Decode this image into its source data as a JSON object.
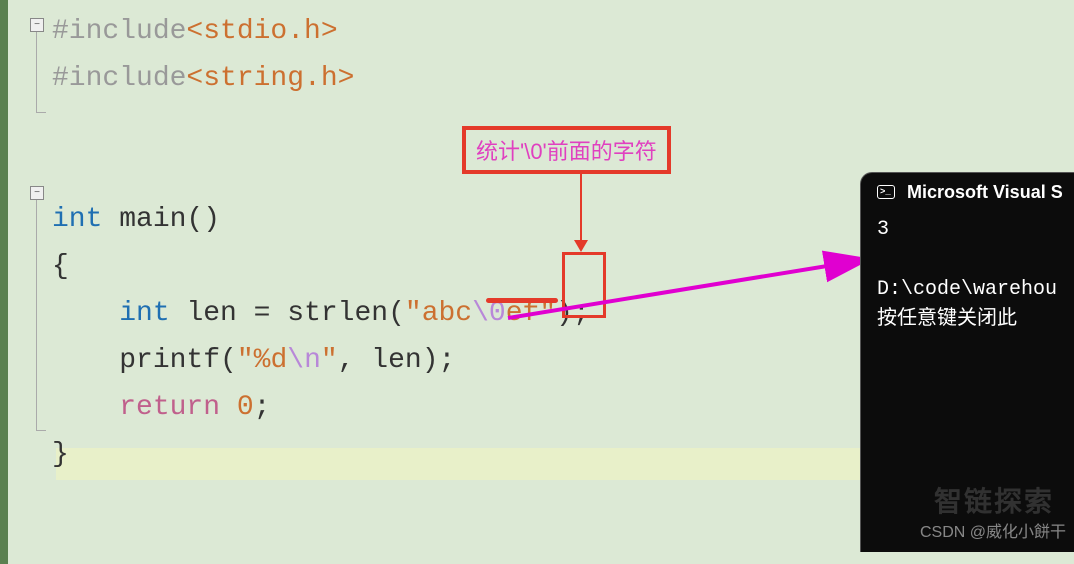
{
  "code": {
    "include1": {
      "pre": "#include",
      "hdr": "<stdio.h>"
    },
    "include2": {
      "pre": "#include",
      "hdr": "<string.h>"
    },
    "main_type": "int",
    "main_name": " main()",
    "brace_open": "{",
    "line_decl": {
      "indent": "    ",
      "type": "int",
      "rest": " len = strlen(",
      "str_q1": "\"abc",
      "esc": "\\0",
      "str_q2": "ef\"",
      "end": ");"
    },
    "line_print": {
      "indent": "    ",
      "fn": "printf(",
      "str": "\"%d",
      "esc": "\\n",
      "str2": "\"",
      "rest": ", len);"
    },
    "line_ret": {
      "indent": "    ",
      "kw": "return",
      "sp": " ",
      "num": "0",
      "end": ";"
    },
    "brace_close": "}"
  },
  "annotation": {
    "label": "统计'\\0'前面的字符"
  },
  "console": {
    "title": "Microsoft Visual S",
    "output": "3",
    "blank": "",
    "path": "D:\\code\\warehou",
    "prompt": "按任意键关闭此"
  },
  "watermark": "智链探索",
  "csdn": "CSDN @威化小餅干",
  "fold": {
    "minus": "−"
  }
}
